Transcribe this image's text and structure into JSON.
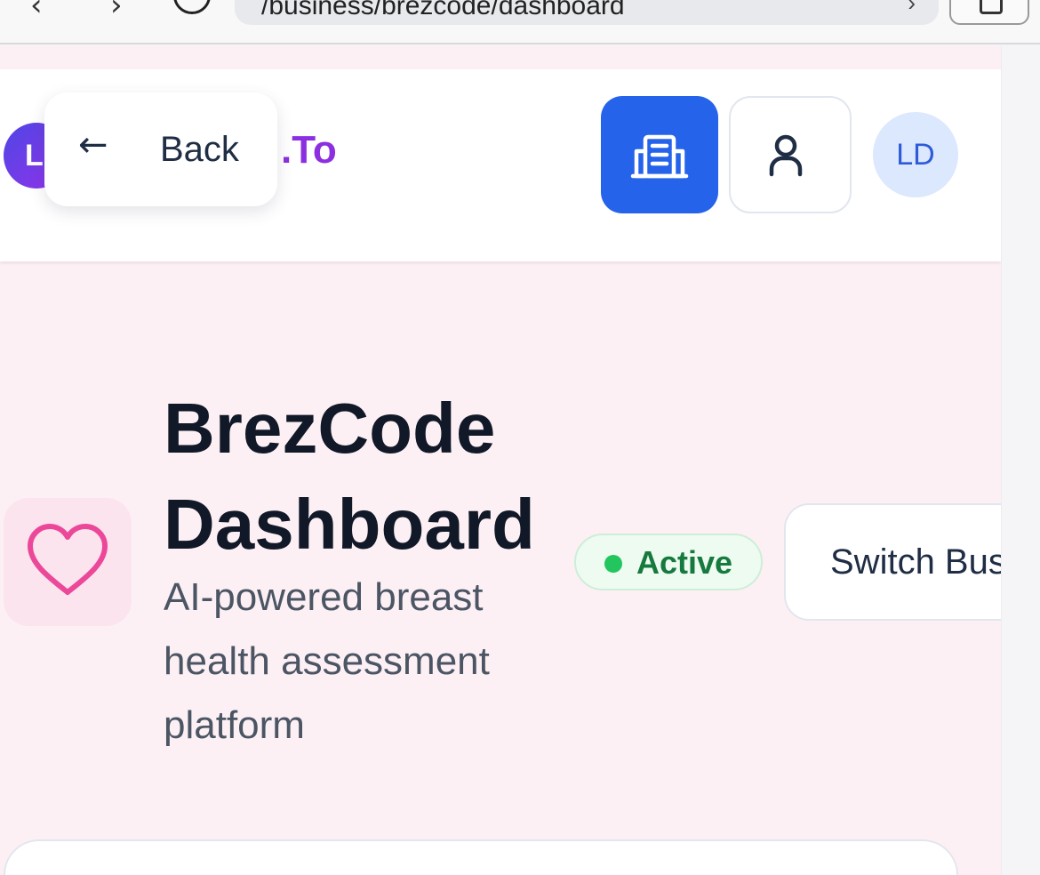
{
  "browser": {
    "url": "/business/brezcode/dashboard",
    "back_glyph": "‹",
    "forward_glyph": "›",
    "url_arrow": "›"
  },
  "header": {
    "logo_initial": "L",
    "logo_text": ".To",
    "back_button": {
      "arrow": "←",
      "label": "Back"
    },
    "avatar_initials": "LD",
    "icons": {
      "business": "building-icon",
      "profile": "user-icon"
    }
  },
  "hero": {
    "icon": "heart-icon",
    "title": "BrezCode Dashboard",
    "subtitle": "AI-powered breast health assessment platform",
    "status": "Active",
    "switch_label": "Switch Busin"
  },
  "colors": {
    "accent_blue": "#2563eb",
    "heart_pink": "#ec4899",
    "status_green": "#22c55e",
    "page_background": "#fdf0f4"
  }
}
